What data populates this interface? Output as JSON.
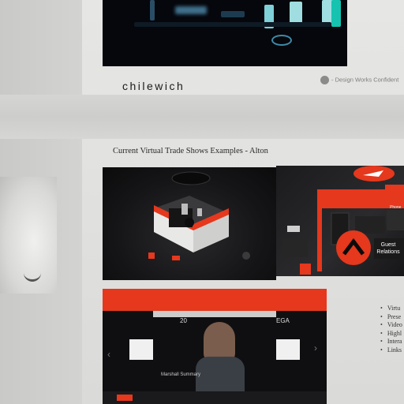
{
  "brand": {
    "name": "chilewich"
  },
  "confidential": {
    "text": "- Design Works Confident"
  },
  "section": {
    "heading": "Current Virtual Trade Shows Examples - Alton"
  },
  "alton_booth": {
    "guest_relations": "Guest Relations",
    "phone_label": "Phone"
  },
  "video": {
    "title": "Marshall Summary",
    "top_text": "20",
    "right_text": "EGA"
  },
  "bullets": [
    "Virtu",
    "Prese",
    "Video",
    "Highl",
    "Intera",
    "Links"
  ],
  "colors": {
    "accent": "#e5381d",
    "dark": "#0b0b0c",
    "page": "#e3e3e1"
  }
}
